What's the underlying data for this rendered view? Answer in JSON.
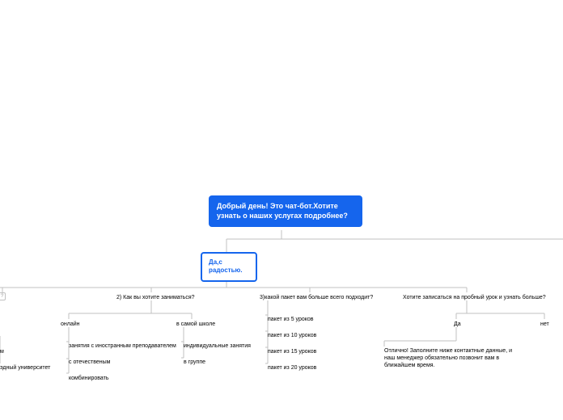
{
  "root": "Добрый день! Это чат-бот.Хотите узнать о наших услугах подробнее?",
  "yes": "Да,с радостью.",
  "q1_cut": "?",
  "q2": "2) Как вы хотите заниматься?",
  "q2_a": "онлайн",
  "q2_a1": "занятия с иностранным преподавателем",
  "q2_a2": "с отечественым",
  "q2_a3": "комбинировать",
  "q2_b": "в самой школе",
  "q2_b1": "индивидуальные занятия",
  "q2_b2": "в группе",
  "q3": "3)какой пакет вам больше всего подходит?",
  "q3_1": "пакет из 5 уроков",
  "q3_2": "пакет из 10 уроков",
  "q3_3": "пакет из 15 уроков",
  "q3_4": "пакет из 20 уроков",
  "q4": "Хотите записаться на пробный урок и узнать больше?",
  "q4_a": "Да",
  "q4_a1": "Отлично! Заполните ниже контактные данные, и наш менеджер обязательно позвонит вам в ближайшем время.",
  "q4_b": "нет",
  "cut1": "м",
  "cut2": "эдный университет"
}
